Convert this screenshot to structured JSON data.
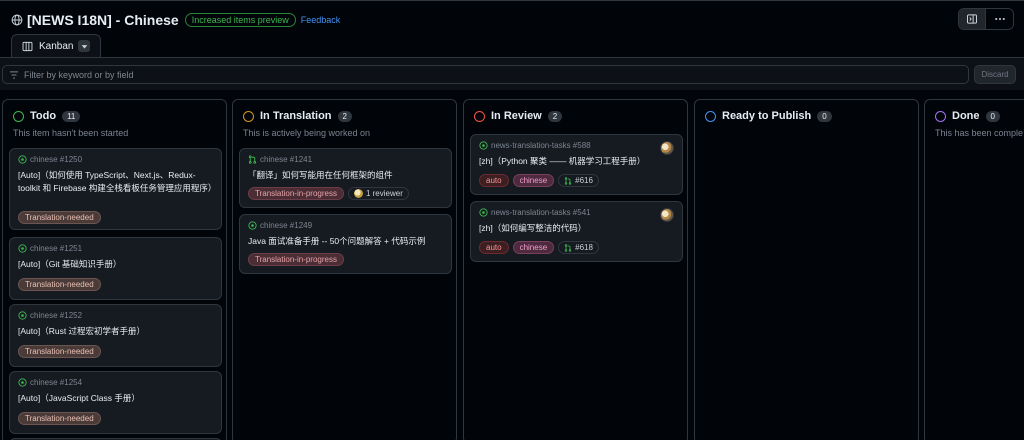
{
  "header": {
    "title": "[NEWS I18N] - Chinese",
    "preview_badge": "Increased items preview",
    "feedback_link": "Feedback"
  },
  "view_tab": {
    "label": "Kanban"
  },
  "filter": {
    "placeholder": "Filter by keyword or by field",
    "discard_label": "Discard"
  },
  "colors": {
    "todo": "#3fb950",
    "in_translation": "#d29922",
    "in_review": "#f85149",
    "ready": "#4493f8",
    "done": "#a371f7"
  },
  "columns": [
    {
      "name": "Todo",
      "count": "11",
      "description": "This item hasn't been started",
      "cards": [
        {
          "meta": "chinese #1250",
          "title": "[Auto]（如何使用 TypeScript、Next.js、Redux-toolkit 和 Firebase 构建全栈看板任务管理应用程序）",
          "label": "Translation-needed"
        },
        {
          "meta": "chinese #1251",
          "title": "[Auto]（Git 基础知识手册）",
          "label": "Translation-needed"
        },
        {
          "meta": "chinese #1252",
          "title": "[Auto]（Rust 过程宏初学者手册）",
          "label": "Translation-needed"
        },
        {
          "meta": "chinese #1254",
          "title": "[Auto]（JavaScript Class 手册）",
          "label": "Translation-needed"
        }
      ]
    },
    {
      "name": "In Translation",
      "count": "2",
      "description": "This is actively being worked on",
      "cards": [
        {
          "meta": "chinese #1241",
          "title": "「翻译」如何写能用在任何框架的组件",
          "label": "Translation-in-progress",
          "chip": "1 reviewer"
        },
        {
          "meta": "chinese #1249",
          "title": "Java 面试准备手册 -- 50个问题解答 + 代码示例",
          "label": "Translation-in-progress"
        }
      ]
    },
    {
      "name": "In Review",
      "count": "2",
      "description": "",
      "cards": [
        {
          "meta": "news-translation-tasks #588",
          "title": "[zh]（Python 聚类 —— 机器学习工程手册）",
          "labels": [
            "auto",
            "chinese"
          ],
          "pr": "#616"
        },
        {
          "meta": "news-translation-tasks #541",
          "title": "[zh]（如何编写整洁的代码）",
          "labels": [
            "auto",
            "chinese"
          ],
          "pr": "#618"
        }
      ]
    },
    {
      "name": "Ready to Publish",
      "count": "0",
      "description": "",
      "cards": []
    },
    {
      "name": "Done",
      "count": "0",
      "description": "This has been comple",
      "cards": []
    }
  ]
}
